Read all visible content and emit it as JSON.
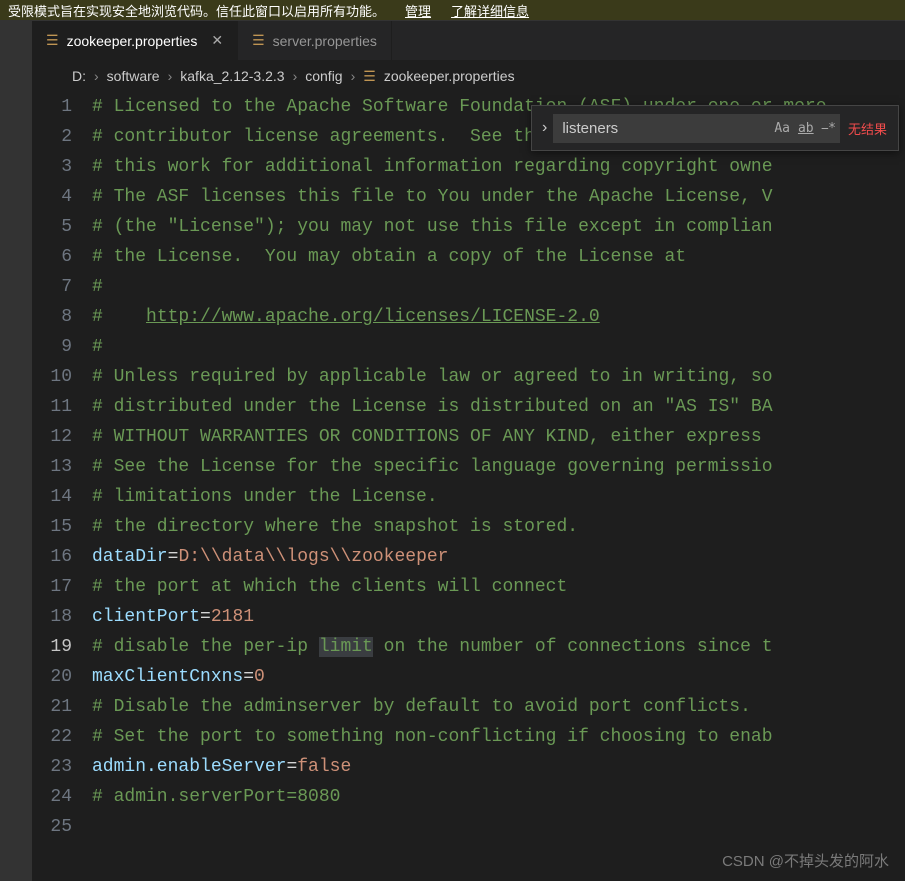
{
  "banner": {
    "text": "受限模式旨在实现安全地浏览代码。信任此窗口以启用所有功能。",
    "manage": "管理",
    "learn_more": "了解详细信息"
  },
  "tabs": {
    "active": {
      "icon": "settings-icon",
      "label": "zookeeper.properties"
    },
    "other": {
      "icon": "settings-icon",
      "label": "server.properties"
    }
  },
  "breadcrumb": {
    "seg0": "D:",
    "seg1": "software",
    "seg2": "kafka_2.12-3.2.3",
    "seg3": "config",
    "seg4": "zookeeper.properties"
  },
  "find": {
    "value": "listeners",
    "case": "Aa",
    "word": "ab",
    "regex": "⎯*",
    "result": "无结果"
  },
  "code": {
    "lines": [
      {
        "n": "1",
        "type": "comment",
        "text": "# Licensed to the Apache Software Foundation (ASF) under one or more"
      },
      {
        "n": "2",
        "type": "comment",
        "text": "# contributor license agreements.  See the NOTICE file distributed"
      },
      {
        "n": "3",
        "type": "comment",
        "text": "# this work for additional information regarding copyright owne"
      },
      {
        "n": "4",
        "type": "comment",
        "text": "# The ASF licenses this file to You under the Apache License, V"
      },
      {
        "n": "5",
        "type": "comment",
        "text": "# (the \"License\"); you may not use this file except in complian"
      },
      {
        "n": "6",
        "type": "comment",
        "text": "# the License.  You may obtain a copy of the License at"
      },
      {
        "n": "7",
        "type": "comment",
        "text": "#"
      },
      {
        "n": "8",
        "type": "commentlink",
        "prefix": "#    ",
        "link": "http://www.apache.org/licenses/LICENSE-2.0"
      },
      {
        "n": "9",
        "type": "comment",
        "text": "#"
      },
      {
        "n": "10",
        "type": "comment",
        "text": "# Unless required by applicable law or agreed to in writing, so"
      },
      {
        "n": "11",
        "type": "comment",
        "text": "# distributed under the License is distributed on an \"AS IS\" BA"
      },
      {
        "n": "12",
        "type": "comment",
        "text": "# WITHOUT WARRANTIES OR CONDITIONS OF ANY KIND, either express "
      },
      {
        "n": "13",
        "type": "comment",
        "text": "# See the License for the specific language governing permissio"
      },
      {
        "n": "14",
        "type": "comment",
        "text": "# limitations under the License."
      },
      {
        "n": "15",
        "type": "comment",
        "text": "# the directory where the snapshot is stored."
      },
      {
        "n": "16",
        "type": "kv",
        "key": "dataDir",
        "val": "D:\\\\data\\\\logs\\\\zookeeper"
      },
      {
        "n": "17",
        "type": "comment",
        "text": "# the port at which the clients will connect"
      },
      {
        "n": "18",
        "type": "kv",
        "key": "clientPort",
        "val": "2181"
      },
      {
        "n": "19",
        "type": "commenthl",
        "before": "# disable the per-ip ",
        "hl": "limit",
        "after": " on the number of connections since t"
      },
      {
        "n": "20",
        "type": "kv",
        "key": "maxClientCnxns",
        "val": "0"
      },
      {
        "n": "21",
        "type": "comment",
        "text": "# Disable the adminserver by default to avoid port conflicts."
      },
      {
        "n": "22",
        "type": "comment",
        "text": "# Set the port to something non-conflicting if choosing to enab"
      },
      {
        "n": "23",
        "type": "kv",
        "key": "admin.enableServer",
        "val": "false"
      },
      {
        "n": "24",
        "type": "comment",
        "text": "# admin.serverPort=8080"
      },
      {
        "n": "25",
        "type": "blank",
        "text": ""
      }
    ]
  },
  "watermark": "CSDN @不掉头发的阿水"
}
